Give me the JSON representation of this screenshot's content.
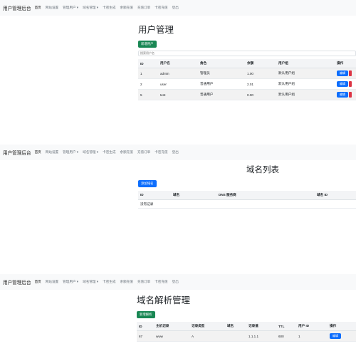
{
  "nav": {
    "brand": "用户管理后台",
    "items": [
      "首页",
      "网站设置",
      "管理用户 ▾",
      "域名管理 ▾",
      "卡密生成",
      "余额充值",
      "充值订单",
      "卡密充值",
      "登出"
    ]
  },
  "users_page": {
    "title": "用户管理",
    "add_button": "新增用户",
    "search_placeholder": "搜索用户名",
    "columns": [
      "ID",
      "用户名",
      "角色",
      "余额",
      "用户组",
      "操作"
    ],
    "rows": [
      {
        "id": "1",
        "username": "admin",
        "role": "管理员",
        "balance": "1.00",
        "group": "默认用户组",
        "action": "编辑"
      },
      {
        "id": "2",
        "username": "user",
        "role": "普通用户",
        "balance": "2.01",
        "group": "默认用户组",
        "action": "编辑"
      },
      {
        "id": "5",
        "username": "test",
        "role": "普通用户",
        "balance": "0.00",
        "group": "默认用户组",
        "action": "编辑"
      }
    ]
  },
  "domains_page": {
    "title": "域名列表",
    "add_button": "添加域名",
    "columns": [
      "ID",
      "域名",
      "DNS 服务商",
      "域名 ID"
    ],
    "empty_text": "没有记录"
  },
  "records_page": {
    "title": "域名解析管理",
    "add_button": "新增解析",
    "columns": [
      "ID",
      "主机记录",
      "记录类型",
      "域名",
      "记录值",
      "TTL",
      "用户 ID",
      "操作"
    ],
    "rows": [
      {
        "id": "67",
        "host": "www",
        "type": "A",
        "domain": "",
        "value": "1.1.1.1",
        "ttl": "600",
        "user_id": "1",
        "action": "编辑"
      }
    ]
  }
}
